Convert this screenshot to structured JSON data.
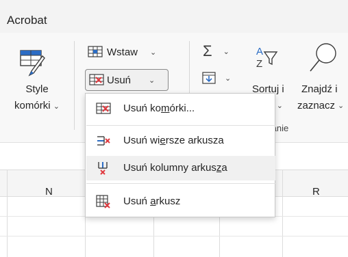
{
  "tab": {
    "label": "Acrobat"
  },
  "ribbon": {
    "style": {
      "line1": "Style",
      "line2": "komórki",
      "chevron": "⌄"
    },
    "wstaw": {
      "label": "Wstaw",
      "chevron": "⌄"
    },
    "usun": {
      "label": "Usuń",
      "chevron": "⌄"
    },
    "sum": {
      "chevron": "⌄"
    },
    "fill": {
      "chevron": "⌄"
    },
    "sort": {
      "line1": "Sortuj i",
      "line2_visible": "uj",
      "chevron": "⌄"
    },
    "find": {
      "line1": "Znajdź i",
      "line2": "zaznacz",
      "chevron": "⌄"
    },
    "group_label_visible": "owanie"
  },
  "grid": {
    "columns": [
      "N",
      "R"
    ]
  },
  "menu": {
    "items": [
      {
        "label_pre": "Usuń ko",
        "label_u": "m",
        "label_post": "órki...",
        "icon": "delete-cells-icon"
      },
      {
        "label_pre": "Usuń wi",
        "label_u": "e",
        "label_post": "rsze arkusza",
        "icon": "delete-rows-icon"
      },
      {
        "label_pre": "Usuń kolumny arkus",
        "label_u": "z",
        "label_post": "a",
        "icon": "delete-columns-icon"
      },
      {
        "label_pre": "Usuń ",
        "label_u": "a",
        "label_post": "rkusz",
        "icon": "delete-sheet-icon"
      }
    ]
  },
  "colors": {
    "accent_blue": "#2b6cc4",
    "delete_red": "#e0383e",
    "ribbon_bg": "#f8f8f8"
  }
}
